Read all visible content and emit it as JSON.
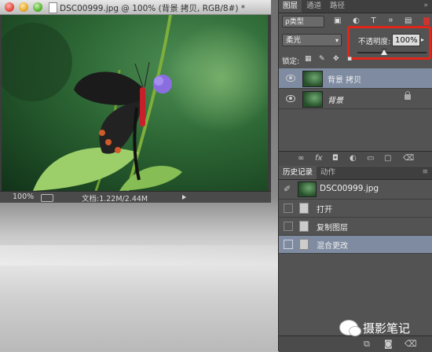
{
  "document": {
    "title": "DSC00999.jpg @ 100% (背景 拷贝, RGB/8#) *",
    "zoom": "100%",
    "doc_size": "文档:1.22M/2.44M"
  },
  "layers_panel": {
    "tabs": [
      "图层",
      "通道",
      "路径"
    ],
    "filter_kind": "ρ类型",
    "blend_mode": "柔光",
    "opacity_label": "不透明度:",
    "opacity_value": "100%",
    "lock_label": "锁定:",
    "layers": [
      {
        "name": "背景 拷贝",
        "selected": true,
        "locked": false
      },
      {
        "name": "背景",
        "selected": false,
        "locked": true
      }
    ]
  },
  "history_panel": {
    "tabs": [
      "历史记录",
      "动作"
    ],
    "snapshot": "DSC00999.jpg",
    "steps": [
      {
        "label": "打开",
        "selected": false
      },
      {
        "label": "复制图层",
        "selected": false
      },
      {
        "label": "混合更改",
        "selected": true
      }
    ]
  },
  "watermark": {
    "text": "摄影笔记"
  },
  "colors": {
    "selection": "#7e8ba1",
    "panel": "#535353",
    "highlight_box": "#e0251b"
  }
}
